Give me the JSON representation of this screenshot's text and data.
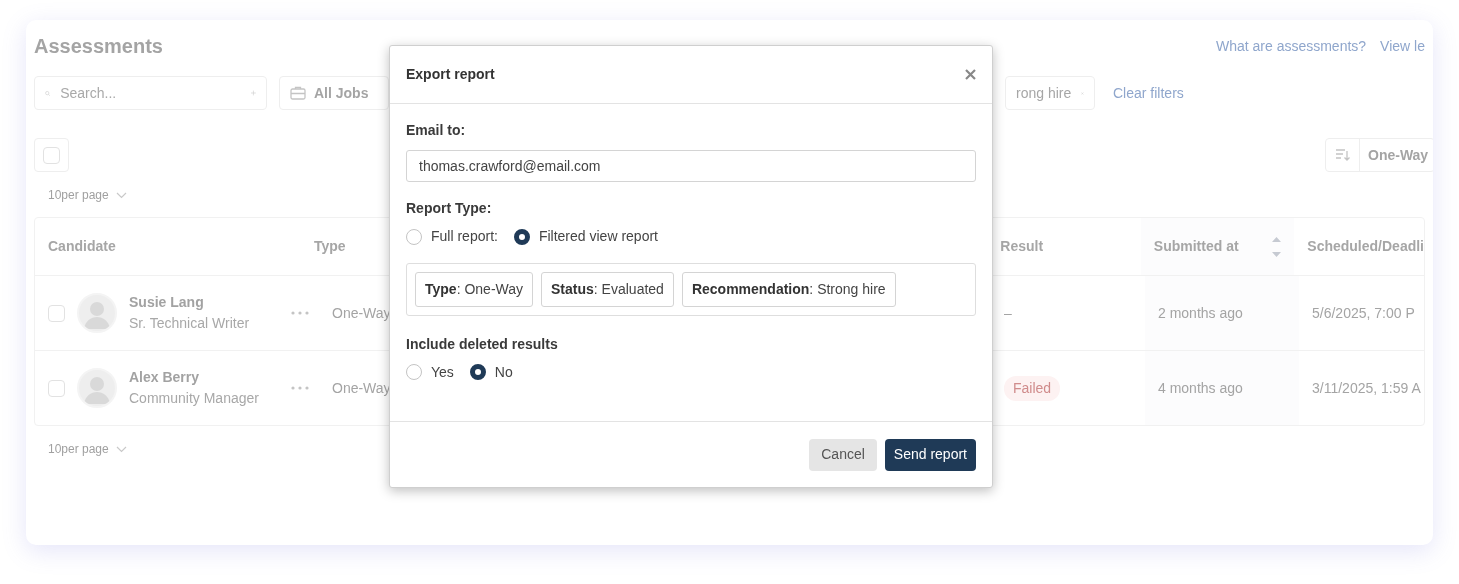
{
  "page": {
    "title": "Assessments",
    "links": [
      "What are assessments?",
      "View le"
    ]
  },
  "toolbar": {
    "search": {
      "placeholder": "Search..."
    },
    "job_filter": "All Jobs",
    "filter_chip": "rong hire",
    "clear_filters": "Clear filters"
  },
  "select_all": {
    "checked": false
  },
  "per_page_top": "10per page",
  "sort": {
    "label": "One-Way"
  },
  "table": {
    "columns": [
      {
        "label": "Candidate",
        "sortable": false
      },
      {
        "label": "Type",
        "sortable": false
      },
      {
        "label": "Result",
        "sortable": false
      },
      {
        "label": "Submitted at",
        "sortable": true
      },
      {
        "label": "Scheduled/Deadli",
        "sortable": false
      }
    ],
    "rows": [
      {
        "checked": false,
        "name": "Susie Lang",
        "role": "Sr. Technical Writer",
        "type": "One-Way",
        "result": {
          "kind": "plain",
          "text": "–"
        },
        "submitted": "2 months ago",
        "scheduled": "5/6/2025, 7:00 P"
      },
      {
        "checked": false,
        "name": "Alex Berry",
        "role": "Community Manager",
        "type": "One-Way",
        "result": {
          "kind": "badge",
          "text": "Failed"
        },
        "submitted": "4 months ago",
        "scheduled": "3/11/2025, 1:59 A"
      }
    ]
  },
  "per_page_bottom": "10per page",
  "dialog": {
    "title": "Export report",
    "email_label": "Email to:",
    "email": "thomas.crawford@email.com",
    "report_type_label": "Report Type:",
    "report_types": [
      {
        "label": "Full report:",
        "selected": false
      },
      {
        "label": "Filtered view report",
        "selected": true
      }
    ],
    "filters": [
      "**Type**: One-Way",
      "**Status**: Evaluated",
      "**Recommendation**: Strong hire"
    ],
    "deleted_label": "Include deleted results",
    "deleted_options": [
      {
        "label": "Yes",
        "selected": false
      },
      {
        "label": "No",
        "selected": true
      }
    ],
    "buttons": [
      {
        "label": "Cancel",
        "kind": "secondary"
      },
      {
        "label": "Send report",
        "kind": "primary"
      }
    ]
  }
}
